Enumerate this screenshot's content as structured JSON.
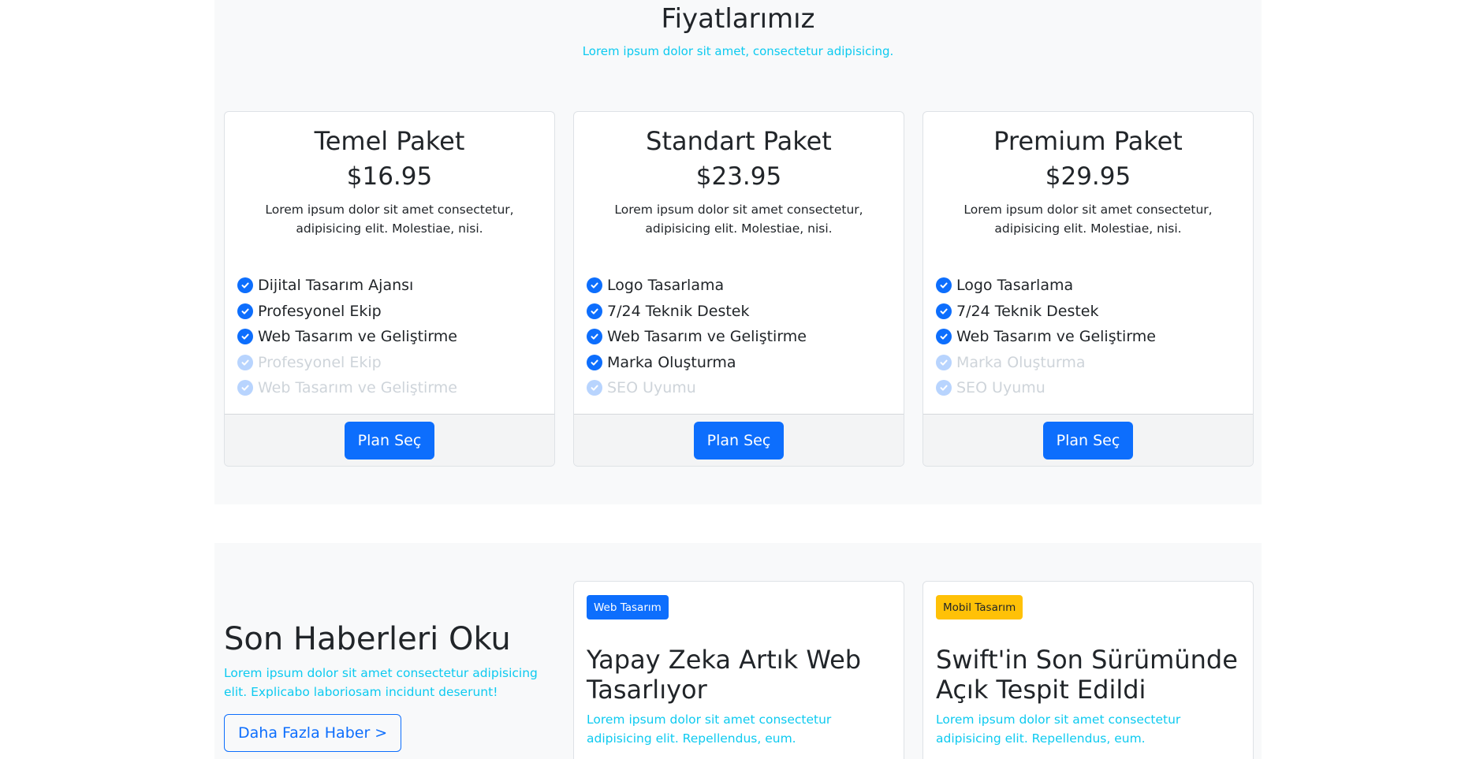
{
  "pricing": {
    "title": "Fiyatlarımız",
    "subtitle": "Lorem ipsum dolor sit amet, consectetur adipisicing.",
    "cards": [
      {
        "name": "Temel Paket",
        "price": "$16.95",
        "description": "Lorem ipsum dolor sit amet consectetur, adipisicing elit. Molestiae, nisi.",
        "features": [
          {
            "label": "Dijital Tasarım Ajansı",
            "enabled": true
          },
          {
            "label": "Profesyonel Ekip",
            "enabled": true
          },
          {
            "label": "Web Tasarım ve Geliştirme",
            "enabled": true
          },
          {
            "label": "Profesyonel Ekip",
            "enabled": false
          },
          {
            "label": "Web Tasarım ve Geliştirme",
            "enabled": false
          }
        ],
        "button": "Plan Seç"
      },
      {
        "name": "Standart Paket",
        "price": "$23.95",
        "description": "Lorem ipsum dolor sit amet consectetur, adipisicing elit. Molestiae, nisi.",
        "features": [
          {
            "label": "Logo Tasarlama",
            "enabled": true
          },
          {
            "label": "7/24 Teknik Destek",
            "enabled": true
          },
          {
            "label": "Web Tasarım ve Geliştirme",
            "enabled": true
          },
          {
            "label": "Marka Oluşturma",
            "enabled": true
          },
          {
            "label": "SEO Uyumu",
            "enabled": false
          }
        ],
        "button": "Plan Seç"
      },
      {
        "name": "Premium Paket",
        "price": "$29.95",
        "description": "Lorem ipsum dolor sit amet consectetur, adipisicing elit. Molestiae, nisi.",
        "features": [
          {
            "label": "Logo Tasarlama",
            "enabled": true
          },
          {
            "label": "7/24 Teknik Destek",
            "enabled": true
          },
          {
            "label": "Web Tasarım ve Geliştirme",
            "enabled": true
          },
          {
            "label": "Marka Oluşturma",
            "enabled": false
          },
          {
            "label": "SEO Uyumu",
            "enabled": false
          }
        ],
        "button": "Plan Seç"
      }
    ]
  },
  "news": {
    "heading": "Son Haberleri Oku",
    "text": "Lorem ipsum dolor sit amet consectetur adipisicing elit. Explicabo laboriosam incidunt deserunt!",
    "button": "Daha Fazla Haber >",
    "cards": [
      {
        "badge": "Web Tasarım",
        "badge_color": "#0d6efd",
        "title": "Yapay Zeka Artık Web Tasarlıyor",
        "text": "Lorem ipsum dolor sit amet consectetur adipisicing elit. Repellendus, eum."
      },
      {
        "badge": "Mobil Tasarım",
        "badge_color": "#ffc107",
        "title": "Swift'in Son Sürümünde Açık Tespit Edildi",
        "text": "Lorem ipsum dolor sit amet consectetur adipisicing elit. Repellendus, eum."
      }
    ]
  },
  "colors": {
    "primary": "#0d6efd",
    "info": "#0dcaf0",
    "warning": "#ffc107",
    "section_bg": "#f8f9fa"
  },
  "icons": {
    "feature_check": "check-circle-icon"
  }
}
